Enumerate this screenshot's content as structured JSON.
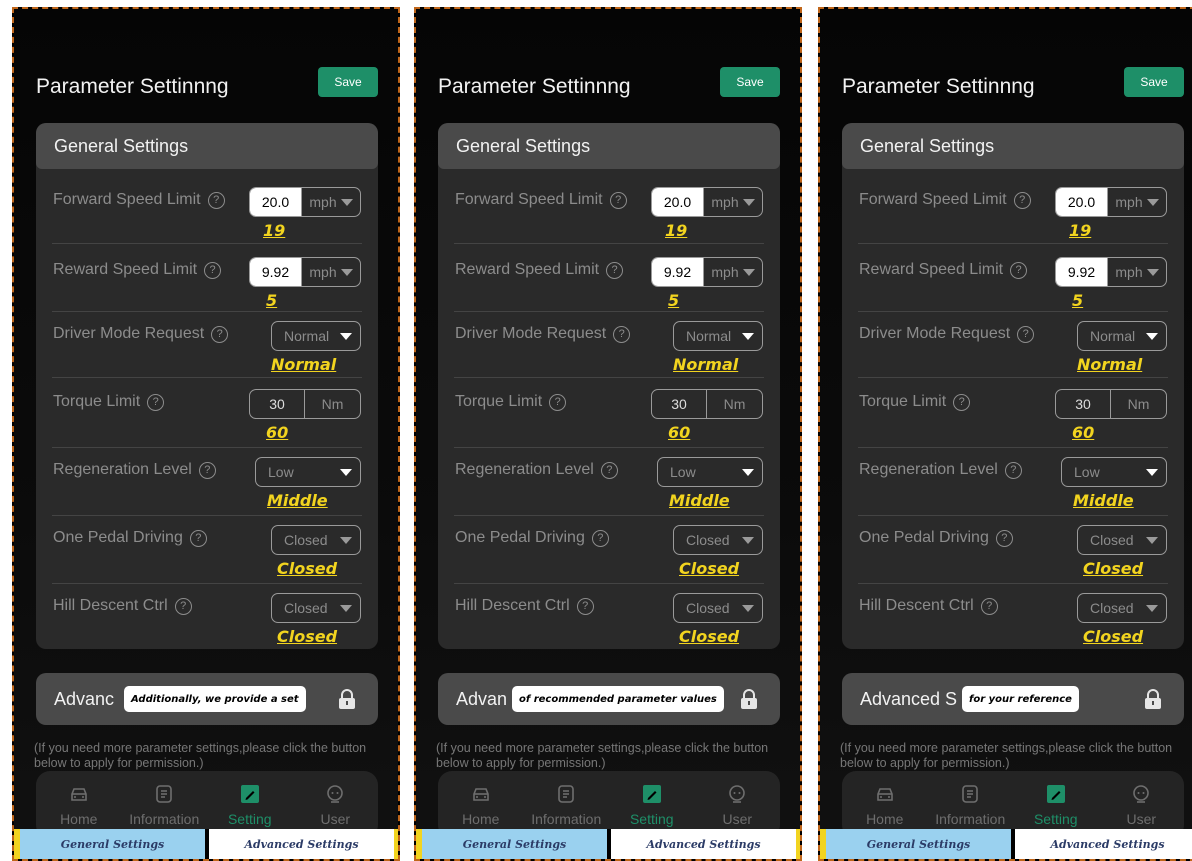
{
  "page": {
    "title": "Parameter Settinnng",
    "save_label": "Save"
  },
  "general": {
    "header": "General Settings",
    "rows": [
      {
        "label": "Forward Speed Limit",
        "value": "20.0",
        "unit": "mph",
        "annotation": "19"
      },
      {
        "label": "Reward Speed Limit",
        "value": "9.92",
        "unit": "mph",
        "annotation": "5"
      },
      {
        "label": "Driver Mode Request",
        "value": "Normal",
        "annotation": "Normal"
      },
      {
        "label": "Torque Limit",
        "value": "30",
        "unit": "Nm",
        "annotation": "60"
      },
      {
        "label": "Regeneration Level",
        "value": "Low",
        "annotation": "Middle"
      },
      {
        "label": "One Pedal Driving",
        "value": "Closed",
        "annotation": "Closed"
      },
      {
        "label": "Hill Descent Ctrl",
        "value": "Closed",
        "annotation": "Closed"
      }
    ]
  },
  "advanced": {
    "panels": [
      {
        "header_visible": "Advanc",
        "tooltip": "Additionally, we provide a set"
      },
      {
        "header_visible": "Advan",
        "tooltip": "of recommended parameter values"
      },
      {
        "header_visible": "Advanced S",
        "tooltip": "for your reference"
      }
    ],
    "hint": "(If you need more parameter settings,please click the button below to apply for permission.)"
  },
  "tabs": [
    {
      "label": "Home",
      "icon": "car-icon"
    },
    {
      "label": "Information",
      "icon": "document-icon"
    },
    {
      "label": "Setting",
      "icon": "edit-icon",
      "active": true
    },
    {
      "label": "User",
      "icon": "user-icon"
    }
  ],
  "bottom_tabs": {
    "general": "General Settings",
    "advanced": "Advanced Settings"
  },
  "colors": {
    "accent": "#1e8f68",
    "annotation": "#f2d41f",
    "background": "#000000",
    "card": "#2a2a2a"
  }
}
